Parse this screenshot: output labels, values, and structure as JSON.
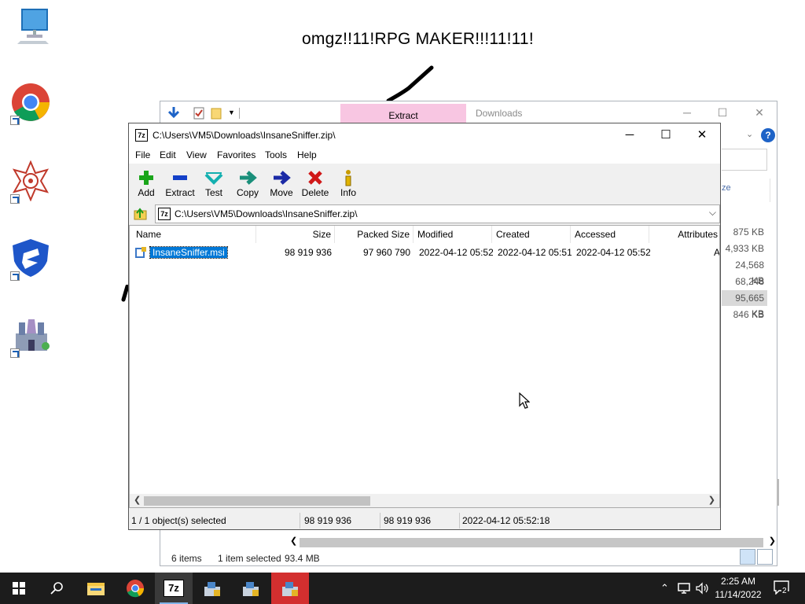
{
  "desktop": {
    "wallpaper_text": "omgz!!11!RPG MAKER!!!11!11!",
    "icons": [
      "this-pc",
      "google-chrome",
      "app-mandala",
      "security-app",
      "castle-game"
    ]
  },
  "explorer": {
    "tab_extract": "Extract",
    "title": "Downloads",
    "search_partial": "ze",
    "sizes": [
      "875 KB",
      "4,933 KB",
      "24,568 KB",
      "68,248 KB",
      "95,665 KB",
      "846 KB"
    ],
    "status": {
      "items": "6 items",
      "selected": "1 item selected",
      "size": "93.4 MB"
    }
  },
  "sevenzip": {
    "title": "C:\\Users\\VM5\\Downloads\\InsaneSniffer.zip\\",
    "app_icon_label": "7z",
    "menu": [
      "File",
      "Edit",
      "View",
      "Favorites",
      "Tools",
      "Help"
    ],
    "toolbar": [
      "Add",
      "Extract",
      "Test",
      "Copy",
      "Move",
      "Delete",
      "Info"
    ],
    "address": "C:\\Users\\VM5\\Downloads\\InsaneSniffer.zip\\",
    "columns": [
      "Name",
      "Size",
      "Packed Size",
      "Modified",
      "Created",
      "Accessed",
      "Attributes"
    ],
    "rows": [
      {
        "name": "InsaneSniffer.msi",
        "size": "98 919 936",
        "packed": "97 960 790",
        "modified": "2022-04-12 05:52",
        "created": "2022-04-12 05:51",
        "accessed": "2022-04-12 05:52",
        "attributes": "A"
      }
    ],
    "status": {
      "selection": "1 / 1 object(s) selected",
      "size": "98 919 936",
      "packed": "98 919 936",
      "date": "2022-04-12 05:52:18"
    }
  },
  "taskbar": {
    "clock_time": "2:25 AM",
    "clock_date": "11/14/2022",
    "notification_count": "2",
    "running_7zip_label": "7z"
  },
  "colors": {
    "selection": "#0078d7",
    "taskbar": "#1c1c1c",
    "extract_tab": "#f8c6e2"
  }
}
